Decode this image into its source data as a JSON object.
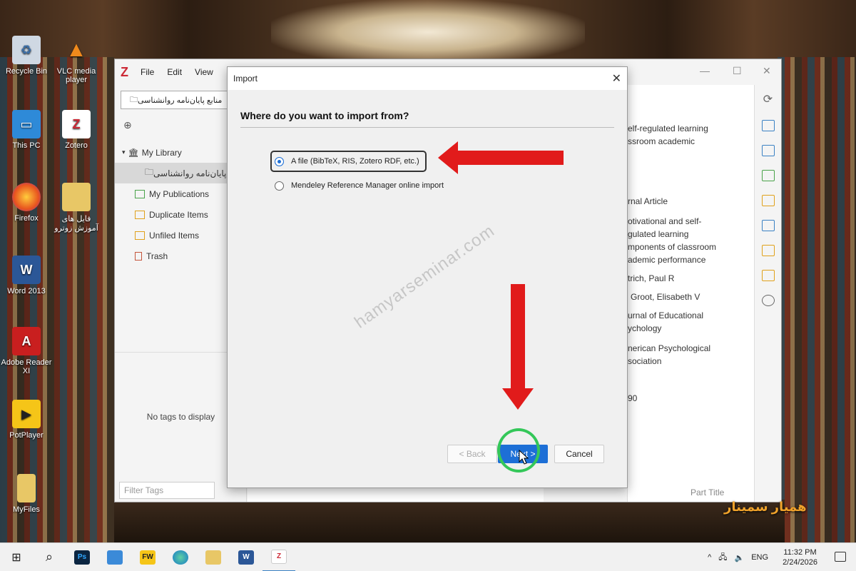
{
  "desktop": {
    "icons": [
      {
        "label": "Recycle Bin"
      },
      {
        "label": "VLC media player"
      },
      {
        "label": "This PC"
      },
      {
        "label": "Zotero"
      },
      {
        "label": "Firefox"
      },
      {
        "label": "فایل های آموزش زوترو"
      },
      {
        "label": "Word 2013"
      },
      {
        "label": "Adobe Reader XI"
      },
      {
        "label": "PotPlayer"
      },
      {
        "label": "MyFiles"
      }
    ]
  },
  "zotero": {
    "menu": [
      "File",
      "Edit",
      "View"
    ],
    "collection_header": "منابع پایان‌نامه روانشناسی",
    "tree": [
      {
        "label": "My Library"
      },
      {
        "label": "منابع پایان‌نامه روانشناسی"
      },
      {
        "label": "My Publications"
      },
      {
        "label": "Duplicate Items"
      },
      {
        "label": "Unfiled Items"
      },
      {
        "label": "Trash"
      }
    ],
    "tags_empty": "No tags to display",
    "filter_placeholder": "Filter Tags",
    "right_pane": {
      "title_fragment_1": "elf-regulated learning",
      "title_fragment_2": "ssroom academic",
      "type": "rnal Article",
      "t1": "otivational and self-",
      "t2": "gulated learning",
      "t3": "mponents of classroom",
      "t4": "ademic performance",
      "a1": "trich,  Paul R",
      "a2": "Groot,  Elisabeth V",
      "p1": "urnal of Educational",
      "p2": "ychology",
      "pub1": "nerican Psychological",
      "pub2": "sociation",
      "year": "90",
      "part_title": "Part Title"
    }
  },
  "dialog": {
    "title": "Import",
    "heading": "Where do you want to import from?",
    "option_file": "A file (BibTeX, RIS, Zotero RDF, etc.)",
    "option_mendeley": "Mendeley Reference Manager online import",
    "back_label": "< Back",
    "next_label": "Next >",
    "cancel_label": "Cancel",
    "watermark": "hamyarseminar.com"
  },
  "brand": "همیار سمینار",
  "taskbar": {
    "lang": "ENG",
    "time": "11:32 PM",
    "date": "2/24/2026"
  }
}
